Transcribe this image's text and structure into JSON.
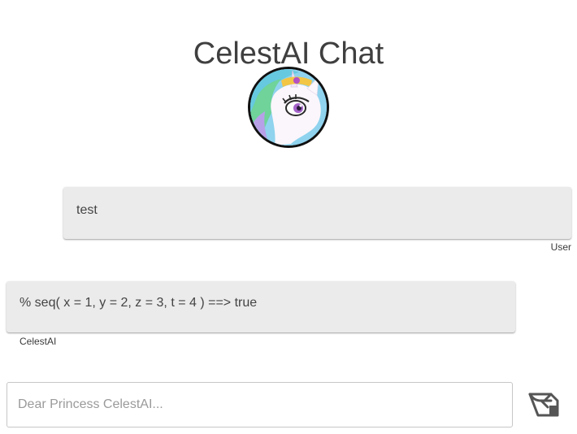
{
  "header": {
    "title": "CelestAI Chat",
    "avatar_icon": "princess-celestia-avatar-icon"
  },
  "messages": [
    {
      "sender": "User",
      "text": "test",
      "align": "right"
    },
    {
      "sender": "CelestAI",
      "text": "% seq( x = 1, y = 2, z = 3, t = 4 ) ==> true",
      "align": "left"
    }
  ],
  "composer": {
    "value": "",
    "placeholder": "Dear Princess CelestAI...",
    "send_icon": "send-scroll-icon"
  },
  "colors": {
    "bubble_bg": "#ebebeb",
    "text": "#444444",
    "title": "#3f3f3f",
    "avatar_border": "#111111"
  }
}
